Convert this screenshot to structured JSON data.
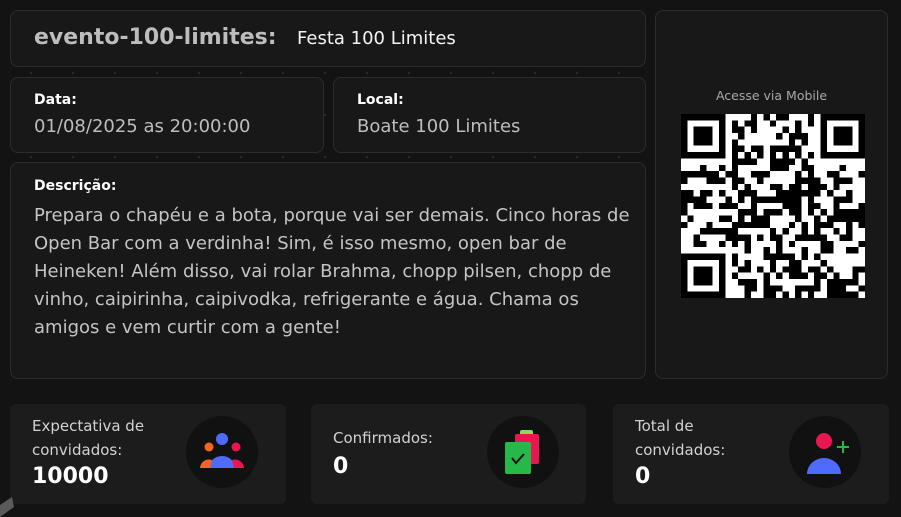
{
  "event": {
    "slug": "evento-100-limites:",
    "name": "Festa 100 Limites"
  },
  "date": {
    "label": "Data:",
    "value": "01/08/2025 as 20:00:00"
  },
  "local": {
    "label": "Local:",
    "value": "Boate 100 Limites"
  },
  "description": {
    "label": "Descrição:",
    "text": "Prepara o chapéu e a bota, porque vai ser demais. Cinco horas de Open Bar com a verdinha! Sim, é isso mesmo, open bar de Heineken! Além disso, vai rolar Brahma, chopp pilsen, chopp de vinho, caipirinha, caipivodka, refrigerante e água. Chama os amigos e vem curtir com a gente!"
  },
  "qr": {
    "caption": "Acesse via Mobile",
    "icon": "qr-code-icon"
  },
  "stats": [
    {
      "label": "Expectativa de convidados:",
      "value": "10000",
      "icon": "people-group-icon"
    },
    {
      "label": "Confirmados:",
      "value": "0",
      "icon": "confirmed-clipboard-icon"
    },
    {
      "label": "Total de convidados:",
      "value": "0",
      "icon": "add-user-icon"
    }
  ],
  "colors": {
    "background": "#131313",
    "card": "#181818",
    "accent_red": "#e8174f",
    "accent_green": "#27b84a",
    "accent_blue": "#4f6bff",
    "accent_orange": "#f26522"
  }
}
